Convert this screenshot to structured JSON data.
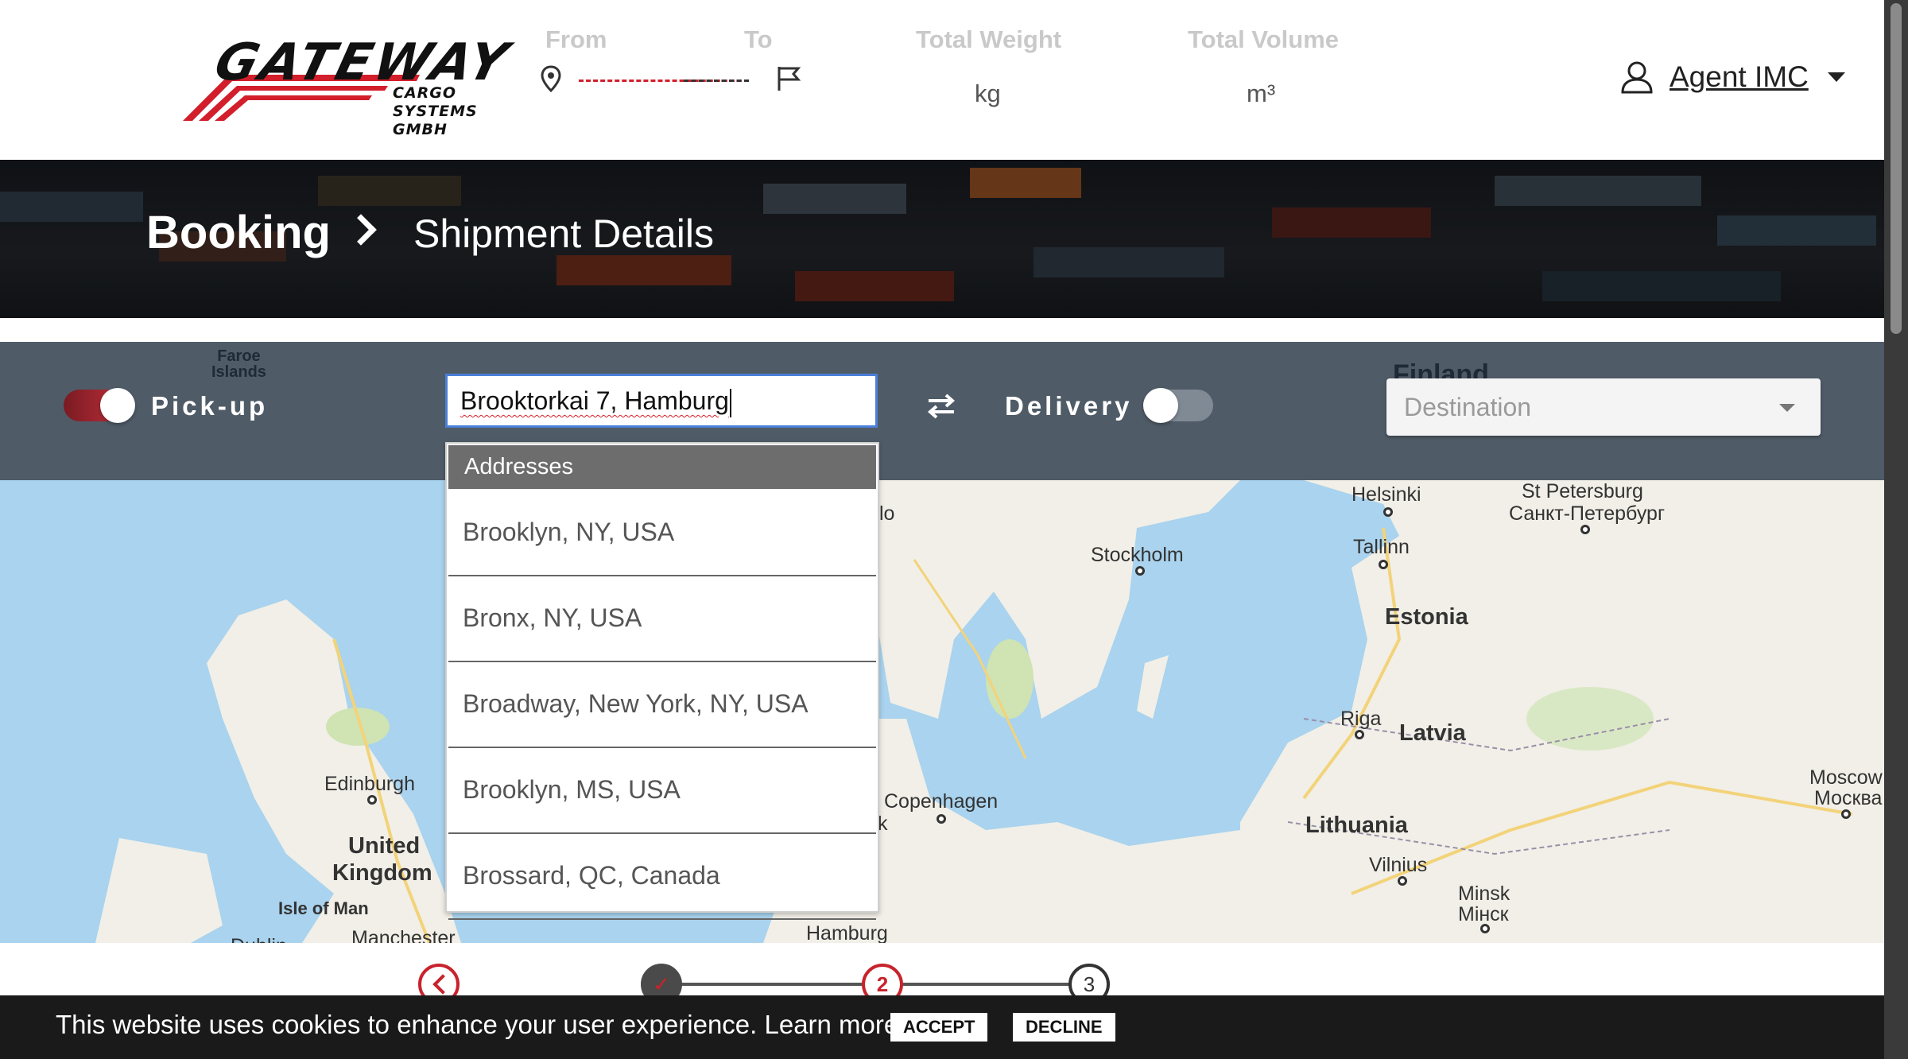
{
  "header": {
    "logo": {
      "word": "GATEWAY",
      "sub_line1": "CARGO",
      "sub_line2": "SYSTEMS GMBH"
    },
    "from_label": "From",
    "to_label": "To",
    "weight_label": "Total Weight",
    "weight_unit": "kg",
    "volume_label": "Total Volume",
    "volume_unit": "m³",
    "user_name": "Agent IMC"
  },
  "hero": {
    "breadcrumb_root": "Booking",
    "breadcrumb_current": "Shipment Details"
  },
  "controls": {
    "pickup_label": "Pick-up",
    "pickup_on": true,
    "address_value": "Brooktorkai 7, Hamburg",
    "delivery_label": "Delivery",
    "delivery_on": false,
    "destination_placeholder": "Destination"
  },
  "dropdown": {
    "header": "Addresses",
    "items": [
      "Brooklyn, NY, USA",
      "Bronx, NY, USA",
      "Broadway, New York, NY, USA",
      "Brooklyn, MS, USA",
      "Brossard, QC, Canada"
    ]
  },
  "map": {
    "labels_top": {
      "faroe": "Faroe\nIslands",
      "finland": "Finland"
    },
    "cities": {
      "helsinki": "Helsinki",
      "st_petersburg": "St Petersburg",
      "st_petersburg_ru": "Санкт-Петербург",
      "stockholm": "Stockholm",
      "tallinn": "Tallinn",
      "oslo_frag": "lo",
      "riga": "Riga",
      "edinburgh": "Edinburgh",
      "copenhagen": "Copenhagen",
      "copenhagen_frag": "k",
      "moscow": "Moscow",
      "moscow_ru": "Москва",
      "vilnius": "Vilnius",
      "minsk": "Minsk",
      "minsk_ru": "Мінск",
      "isle_of_man": "Isle of Man",
      "manchester": "Manchester",
      "dublin_frag": "Dublin",
      "hamburg": "Hamburg"
    },
    "countries": {
      "estonia": "Estonia",
      "latvia": "Latvia",
      "lithuania": "Lithuania",
      "uk_line1": "United",
      "uk_line2": "Kingdom"
    }
  },
  "stepper": {
    "step1": "✓",
    "step2": "2",
    "step3": "3"
  },
  "cookie": {
    "message": "This website uses cookies to enhance your user experience. Learn more",
    "accept": "ACCEPT",
    "decline": "DECLINE"
  },
  "colors": {
    "brand_red": "#c8232c",
    "control_bar": "#4f5b67",
    "water": "#a9d3ee",
    "land": "#f1efe7"
  }
}
